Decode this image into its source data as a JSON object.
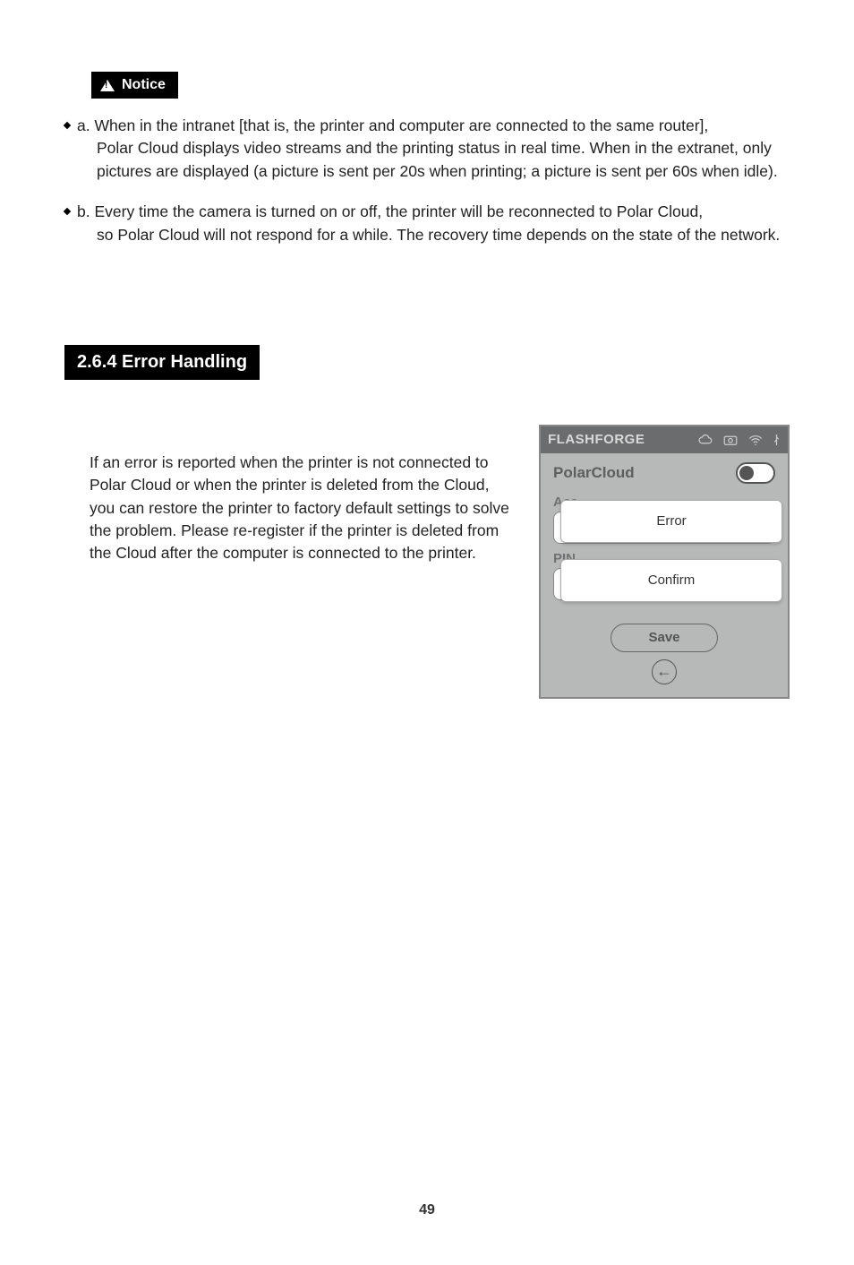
{
  "notice_label": "Notice",
  "notice_a_first": "a. When in the intranet [that is, the printer and computer are connected to the same router],",
  "notice_a_rest": "Polar Cloud displays video streams and the printing status in real time. When in the extranet, only pictures are displayed (a picture is sent per 20s when printing; a picture is sent per 60s when idle).",
  "notice_b_first": "b. Every time the camera is turned on or off, the printer will be reconnected to Polar Cloud,",
  "notice_b_rest": "so Polar Cloud will not respond for a while. The recovery time depends on the state of the network.",
  "section_heading": "2.6.4 Error Handling",
  "body_para": "If an error is reported when the printer is not connected to Polar Cloud or when the printer is deleted from the Cloud, you can restore the printer to factory default settings to solve the problem. Please re-register if the printer is deleted from the Cloud after the computer is connected to the printer.",
  "device": {
    "brand": "FLASHFORGE",
    "title": "PolarCloud",
    "acc_label": "Acc",
    "pin_label": "PIN",
    "save_label": "Save",
    "error_label": "Error",
    "confirm_label": "Confirm",
    "back_glyph": "←"
  },
  "page_number": "49"
}
